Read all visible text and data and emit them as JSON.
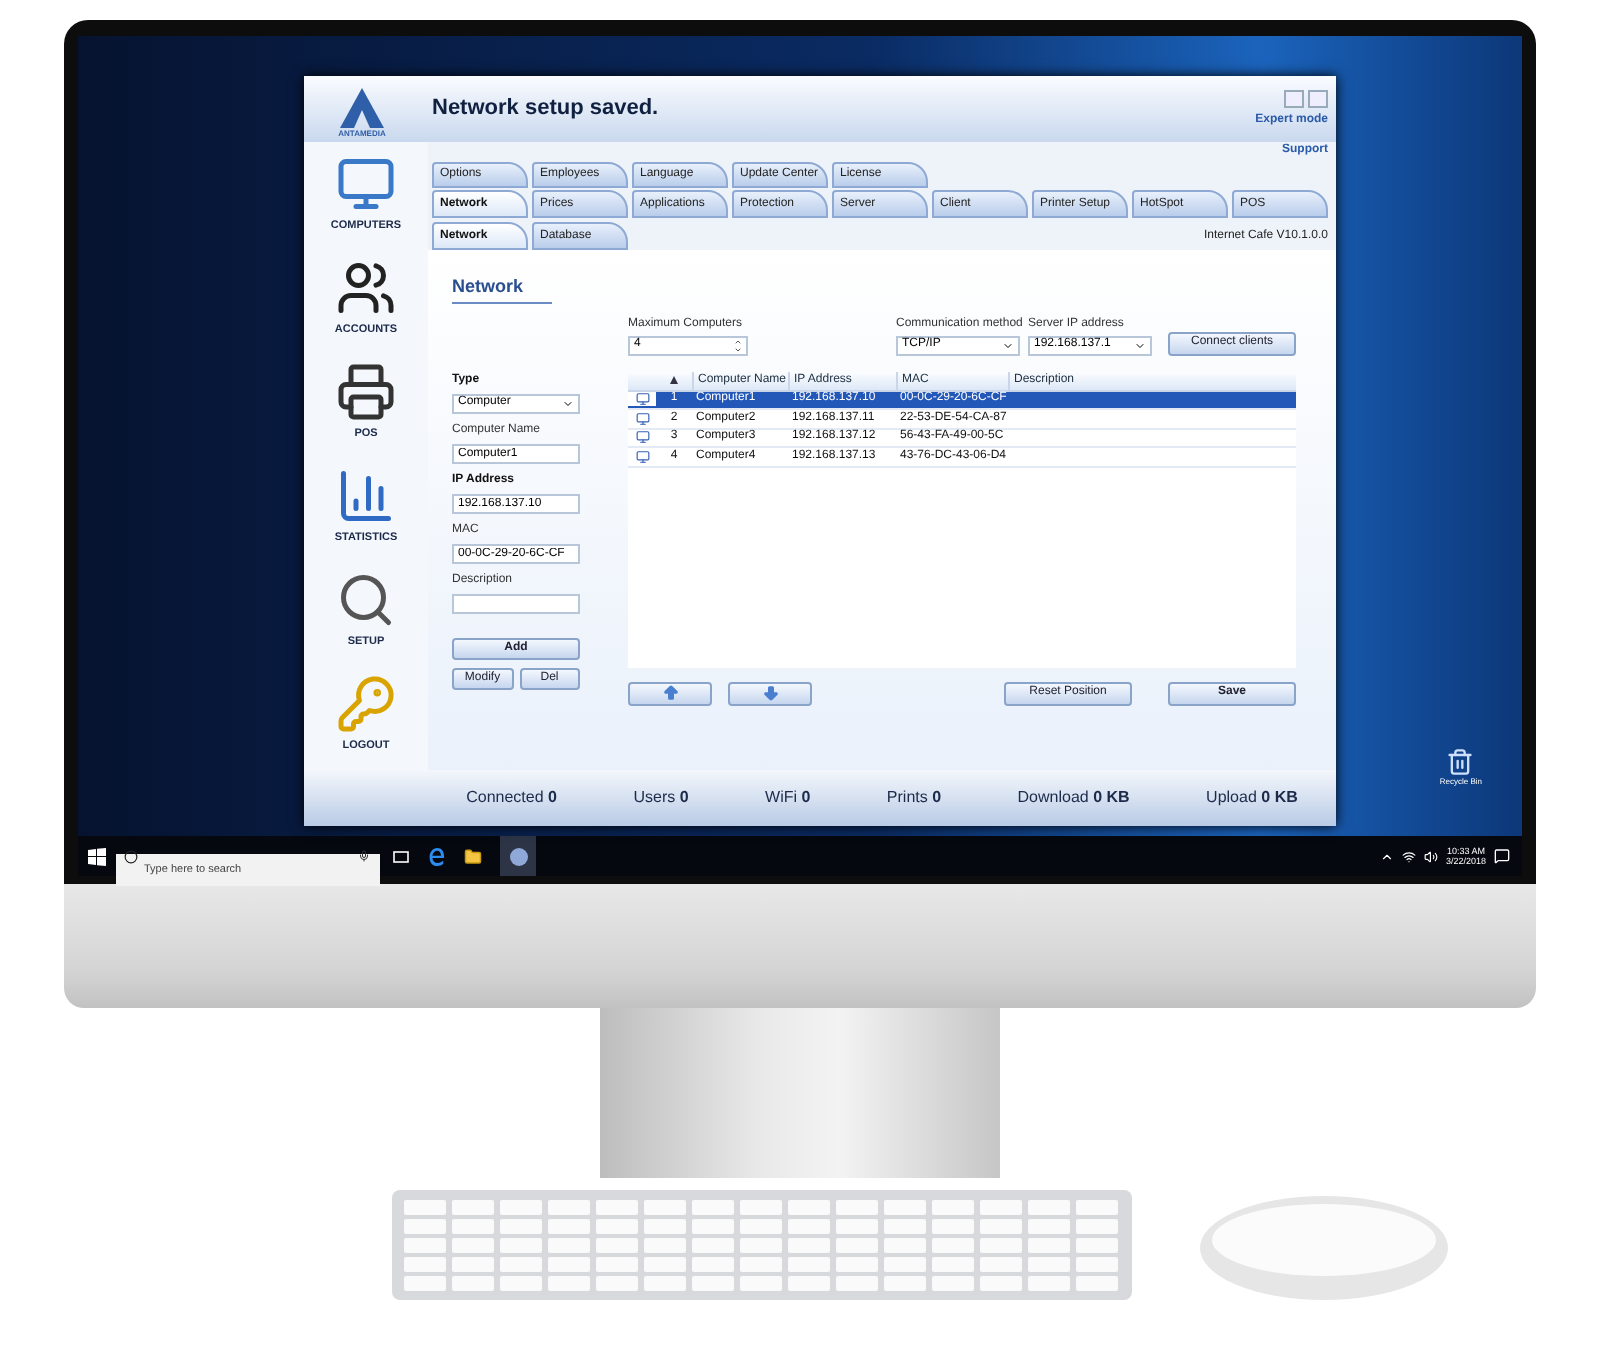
{
  "window": {
    "title": "Network setup saved.",
    "expert_link": "Expert mode",
    "support_link": "Support"
  },
  "logo": {
    "text": "ANTAMEDIA"
  },
  "sidebar": {
    "items": [
      {
        "kind": "computers",
        "label": "COMPUTERS"
      },
      {
        "kind": "accounts",
        "label": "ACCOUNTS"
      },
      {
        "kind": "pos",
        "label": "POS"
      },
      {
        "kind": "statistics",
        "label": "STATISTICS"
      },
      {
        "kind": "setup",
        "label": "SETUP"
      },
      {
        "kind": "logout",
        "label": "LOGOUT"
      }
    ]
  },
  "tabs_row_1": [
    {
      "label": "Options",
      "selected": false
    },
    {
      "label": "Employees",
      "selected": false
    },
    {
      "label": "Language",
      "selected": false
    },
    {
      "label": "Update Center",
      "selected": false
    },
    {
      "label": "License",
      "selected": false
    }
  ],
  "tabs_row_2": [
    {
      "label": "Network",
      "selected": true
    },
    {
      "label": "Prices",
      "selected": false
    },
    {
      "label": "Applications",
      "selected": false
    },
    {
      "label": "Protection",
      "selected": false
    },
    {
      "label": "Server",
      "selected": false
    },
    {
      "label": "Client",
      "selected": false
    },
    {
      "label": "Printer Setup",
      "selected": false
    },
    {
      "label": "HotSpot",
      "selected": false
    },
    {
      "label": "POS",
      "selected": false
    }
  ],
  "subtabs": [
    {
      "label": "Network",
      "selected": true
    },
    {
      "label": "Database",
      "selected": false
    }
  ],
  "version": "Internet Cafe V10.1.0.0",
  "section_title": "Network",
  "form": {
    "fields": [
      {
        "kind": "select",
        "label": "Type",
        "emphasized": true,
        "value": "Computer"
      },
      {
        "kind": "text",
        "label": "Computer Name",
        "emphasized": false,
        "value": "Computer1"
      },
      {
        "kind": "text",
        "label": "IP Address",
        "emphasized": true,
        "value": "192.168.137.10"
      },
      {
        "kind": "text",
        "label": "MAC",
        "emphasized": false,
        "value": "00-0C-29-20-6C-CF"
      },
      {
        "kind": "text",
        "label": "Description",
        "emphasized": false
      }
    ],
    "add_button": "Add",
    "modify_button": "Modify",
    "delete_button": "Del"
  },
  "settings": [
    {
      "kind": "spinner",
      "label": "Maximum Computers",
      "value": "4"
    },
    {
      "kind": "select",
      "label": "Communication method",
      "value": "TCP/IP"
    },
    {
      "kind": "select",
      "label": "Server IP address",
      "value": "192.168.137.1"
    }
  ],
  "connect_button": "Connect clients",
  "table": {
    "number_column": {
      "sorted": true
    },
    "columns": [
      "Computer Name",
      "IP Address",
      "MAC",
      "Description"
    ],
    "rows": [
      {
        "number": "1",
        "name": "Computer1",
        "ip": "192.168.137.10",
        "mac": "00-0C-29-20-6C-CF",
        "selected": true
      },
      {
        "number": "2",
        "name": "Computer2",
        "ip": "192.168.137.11",
        "mac": "22-53-DE-54-CA-87",
        "selected": false
      },
      {
        "number": "3",
        "name": "Computer3",
        "ip": "192.168.137.12",
        "mac": "56-43-FA-49-00-5C",
        "selected": false
      },
      {
        "number": "4",
        "name": "Computer4",
        "ip": "192.168.137.13",
        "mac": "43-76-DC-43-06-D4",
        "selected": false
      }
    ]
  },
  "reset_button": "Reset Position",
  "save_button": "Save",
  "status_bar": [
    {
      "label": "Connected",
      "value": "0"
    },
    {
      "label": "Users",
      "value": "0"
    },
    {
      "label": "WiFi",
      "value": "0"
    },
    {
      "label": "Prints",
      "value": "0"
    },
    {
      "label": "Download",
      "value": "0 KB"
    },
    {
      "label": "Upload",
      "value": "0 KB"
    }
  ],
  "desktop_icon": {
    "label": "Recycle Bin"
  },
  "taskbar": {
    "search_placeholder": "Type here to search",
    "time": "10:33 AM",
    "date": "3/22/2018"
  }
}
